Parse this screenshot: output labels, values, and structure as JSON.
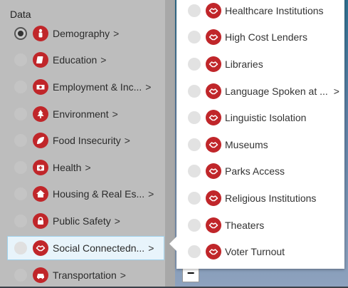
{
  "panel": {
    "title": "Data",
    "categories": [
      {
        "label": "Demography",
        "icon": "person-icon",
        "checked": true
      },
      {
        "label": "Education",
        "icon": "book-icon"
      },
      {
        "label": "Employment & Inc...",
        "icon": "money-icon"
      },
      {
        "label": "Environment",
        "icon": "tree-icon"
      },
      {
        "label": "Food Insecurity",
        "icon": "leaf-icon"
      },
      {
        "label": "Health",
        "icon": "medical-kit-icon"
      },
      {
        "label": "Housing & Real Es...",
        "icon": "house-icon"
      },
      {
        "label": "Public Safety",
        "icon": "lock-icon"
      },
      {
        "label": "Social Connectedn...",
        "icon": "handshake-icon",
        "selected": true
      },
      {
        "label": "Transportation",
        "icon": "car-icon"
      }
    ],
    "chevron": ">"
  },
  "submenu": {
    "items": [
      {
        "label": "Healthcare Institutions"
      },
      {
        "label": "High Cost Lenders"
      },
      {
        "label": "Libraries"
      },
      {
        "label": "Language Spoken at ...",
        "has_submenu": true
      },
      {
        "label": "Linguistic Isolation"
      },
      {
        "label": "Museums"
      },
      {
        "label": "Parks Access"
      },
      {
        "label": "Religious Institutions"
      },
      {
        "label": "Theaters"
      },
      {
        "label": "Voter Turnout"
      }
    ],
    "icon": "handshake-icon",
    "chevron": ">"
  },
  "map": {
    "zoom_out_label": "−"
  },
  "colors": {
    "icon_red": "#c0262a",
    "panel_bg": "#bdbdbd",
    "selected_bg": "#e8f4fb"
  }
}
